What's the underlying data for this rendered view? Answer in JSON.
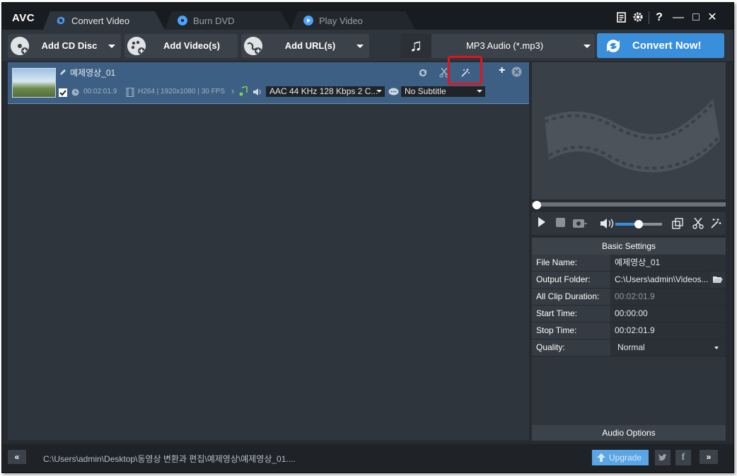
{
  "app": {
    "logo": "AVC"
  },
  "tabs": [
    {
      "label": "Convert Video",
      "icon": "convert-icon",
      "active": true
    },
    {
      "label": "Burn DVD",
      "icon": "disc-icon",
      "active": false
    },
    {
      "label": "Play Video",
      "icon": "play-icon",
      "active": false
    }
  ],
  "window_controls": {
    "help": "?",
    "minimize": "—",
    "maximize": "□",
    "close": "✕"
  },
  "toolbar": {
    "add_cd": "Add CD Disc",
    "add_video": "Add Video(s)",
    "add_url": "Add URL(s)",
    "format": "MP3 Audio (*.mp3)",
    "convert": "Convert Now!"
  },
  "file": {
    "name": "예제영상_01",
    "duration": "00:02:01.9",
    "video_info": "H264 | 1920x1080 | 30 FPS",
    "audio": "AAC 44 KHz 128 Kbps 2 C...",
    "subtitle": "No Subtitle"
  },
  "settings": {
    "header": "Basic Settings",
    "rows": [
      {
        "key": "File Name:",
        "value": "예제영상_01"
      },
      {
        "key": "Output Folder:",
        "value": "C:\\Users\\admin\\Videos..."
      },
      {
        "key": "All Clip Duration:",
        "value": "00:02:01.9"
      },
      {
        "key": "Start Time:",
        "value": "00:00:00"
      },
      {
        "key": "Stop Time:",
        "value": "00:02:01.9"
      },
      {
        "key": "Quality:",
        "value": "Normal"
      }
    ],
    "audio_options": "Audio Options"
  },
  "player": {
    "volume_percent": 50,
    "seek_percent": 0
  },
  "status": {
    "path": "C:\\Users\\admin\\Desktop\\동영상 변환과 편집\\예제영상\\예제영상_01....",
    "upgrade": "Upgrade",
    "collapse": "«",
    "expand": "»"
  },
  "colors": {
    "accent": "#3a8fdc",
    "highlight": "#e3141a",
    "selected_row": "#3e5f84"
  }
}
